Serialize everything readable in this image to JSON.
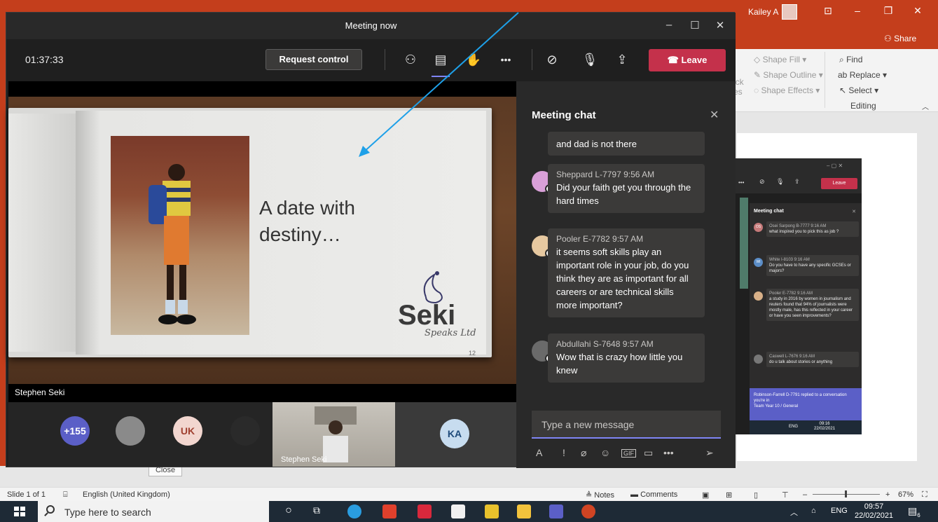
{
  "powerpoint": {
    "user_name": "Kailey A",
    "share_label": "Share",
    "ribbon": {
      "shape_fill": "Shape Fill",
      "shape_outline": "Shape Outline",
      "shape_effects": "Shape Effects",
      "find": "Find",
      "replace": "Replace",
      "select": "Select",
      "group_label": "Editing",
      "partial_left_1": "ick",
      "partial_left_2": "es"
    },
    "close_label": "Close",
    "status": {
      "slide": "Slide 1 of 1",
      "language": "English (United Kingdom)",
      "notes": "Notes",
      "comments": "Comments",
      "zoom": "67%"
    }
  },
  "taskbar": {
    "search_placeholder": "Type here to search",
    "language": "ENG",
    "time": "09:57",
    "date": "22/02/2021",
    "notification_count": "6"
  },
  "teams": {
    "title": "Meeting now",
    "timer": "01:37:33",
    "request_control": "Request control",
    "leave": "Leave",
    "more": "•••",
    "slide": {
      "line1": "A date with",
      "line2": "destiny…",
      "logo_main": "Seki",
      "logo_sub": "Speaks Ltd",
      "page_number": "12"
    },
    "presenter": "Stephen Seki",
    "participants": {
      "overflow": "+155",
      "uk": "UK",
      "ka": "KA",
      "video_name": "Stephen Seki"
    },
    "chat": {
      "header": "Meeting chat",
      "messages": [
        {
          "meta": "",
          "body": "and dad is not there"
        },
        {
          "meta": "Sheppard L-7797   9:56 AM",
          "body": "Did your faith get you through the hard times"
        },
        {
          "meta": "Pooler E-7782   9:57 AM",
          "body": "it seems soft skills play an important role in your job, do you think they are as important for all careers or are technical skills more important?"
        },
        {
          "meta": "Abdullahi S-7648   9:57 AM",
          "body": "Wow that is crazy how little you knew"
        }
      ],
      "compose_placeholder": "Type a new message",
      "more": "•••"
    }
  },
  "mini_teams": {
    "leave": "Leave",
    "chat_header": "Meeting chat",
    "messages": [
      {
        "initials": "OS",
        "meta": "Osei Sarpong B-7777  9:16 AM",
        "body": "what inspired you to pick this as job ?"
      },
      {
        "initials": "WI",
        "meta": "White I-8103  9:16 AM",
        "body": "Do you have to have any specific GCSEs or majors?"
      },
      {
        "initials": "",
        "meta": "Pooler E-7782  9:16 AM",
        "body": "a study in 2016 by women in journalism and reuters found that 94% of journalists were mostly male, has this reflected in your career or have you seen improvements?"
      },
      {
        "initials": "",
        "meta": "Caswell L-7676  9:16 AM",
        "body": "do u talk about stories or anything"
      }
    ],
    "notification": "Robinson-Farrell D-7791 replied to a conversation you're in",
    "notification_sub": "Team Year 10 / General",
    "tray_lang": "ENG",
    "tray_time": "09:16",
    "tray_date": "22/02/2021"
  },
  "colors": {
    "ppt_accent": "#c43e1c",
    "teams_bg": "#1f1f1f",
    "leave_red": "#c4314b",
    "teams_purple": "#5b5fc7",
    "arrow_blue": "#1ea0e8"
  }
}
